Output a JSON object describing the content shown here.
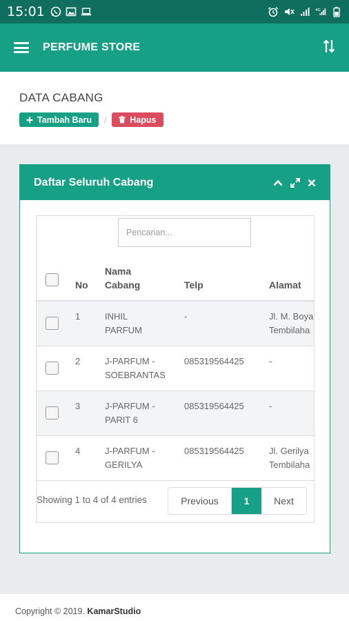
{
  "status_bar": {
    "time": "15:01",
    "left_icons": [
      "whatsapp-icon",
      "image-icon",
      "laptop-icon"
    ],
    "right_icons": [
      "alarm-icon",
      "mute-icon",
      "signal-icon",
      "4g-signal-icon",
      "battery-icon"
    ],
    "network": "4G"
  },
  "app_bar": {
    "title": "PERFUME STORE",
    "menu_icon": "hamburger-icon",
    "action_icon": "sort-arrows-icon"
  },
  "page": {
    "title": "DATA CABANG",
    "add_button": "Tambah Baru",
    "delete_button": "Hapus",
    "separator": "/"
  },
  "panel": {
    "title": "Daftar Seluruh Cabang",
    "tools": [
      "chevron-up-icon",
      "expand-icon",
      "close-icon"
    ]
  },
  "table": {
    "search_placeholder": "Pencarian...",
    "columns": [
      "No",
      "Nama Cabang",
      "Telp",
      "Alamat"
    ],
    "rows": [
      {
        "no": "1",
        "name": "INHIL PARFUM",
        "telp": "-",
        "alamat": "Jl. M. Boya",
        "alamat2": "Tembilaha"
      },
      {
        "no": "2",
        "name": "J-PARFUM - SOEBRANTAS",
        "telp": "085319564425",
        "alamat": "-",
        "alamat2": ""
      },
      {
        "no": "3",
        "name": "J-PARFUM - PARIT 6",
        "telp": "085319564425",
        "alamat": "-",
        "alamat2": ""
      },
      {
        "no": "4",
        "name": "J-PARFUM - GERILYA",
        "telp": "085319564425",
        "alamat": "Jl. Gerilya",
        "alamat2": "Tembilaha"
      }
    ],
    "info": "Showing 1 to 4 of 4 entries",
    "pagination": {
      "previous": "Previous",
      "current": "1",
      "next": "Next"
    }
  },
  "footer": {
    "prefix": "Copyright © 2019.",
    "brand": "KamarStudio"
  },
  "colors": {
    "primary": "#16a085",
    "status_bar": "#0f6e5d",
    "danger": "#dc4c5f"
  }
}
